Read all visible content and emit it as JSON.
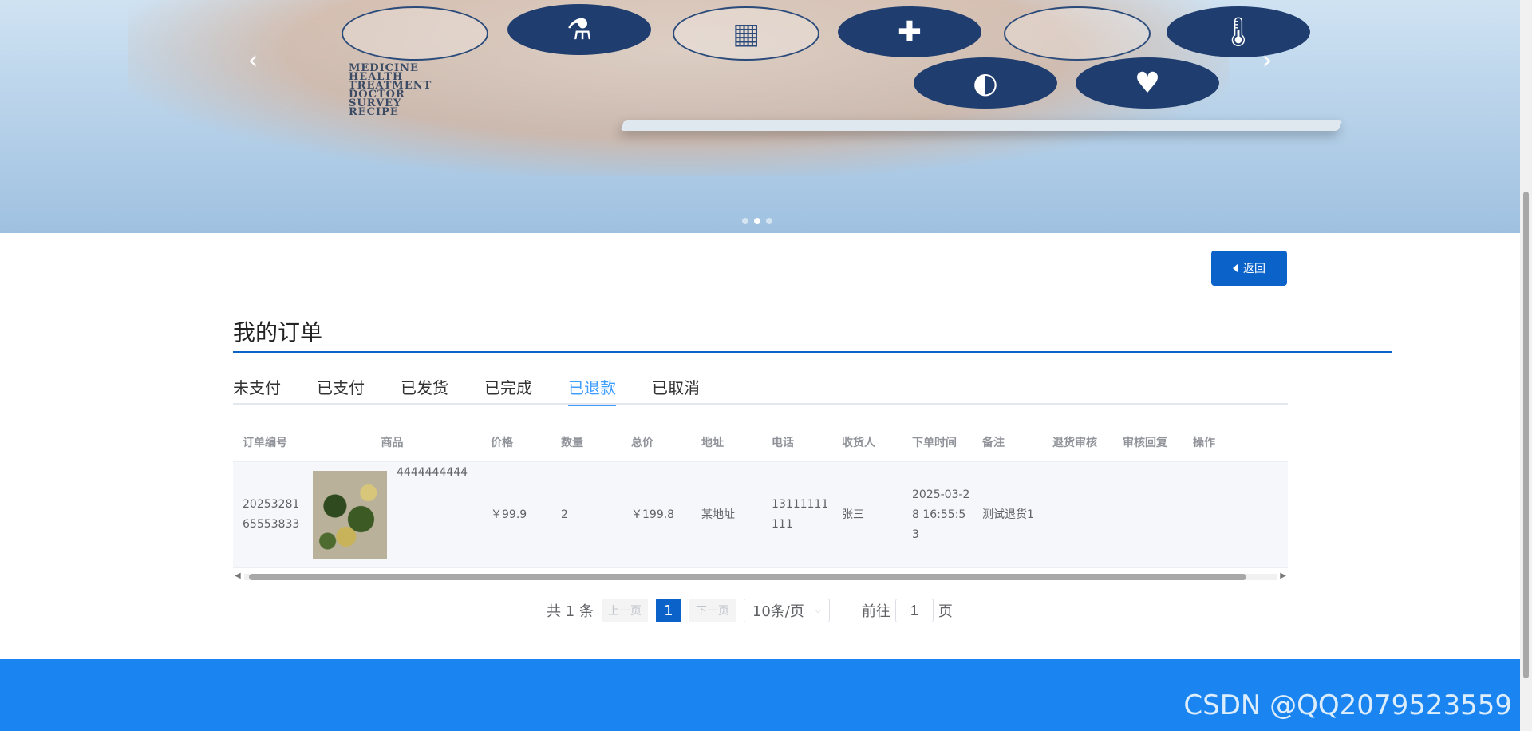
{
  "banner": {
    "text_lines": [
      "MEDICINE",
      "HEALTH",
      "TREATMENT",
      "DOCTOR",
      "SURVEY",
      "RECIPE"
    ],
    "slides": 3,
    "active_slide": 2
  },
  "back_button": {
    "label": "返回"
  },
  "page_title": "我的订单",
  "tabs": [
    "未支付",
    "已支付",
    "已发货",
    "已完成",
    "已退款",
    "已取消"
  ],
  "active_tab": "已退款",
  "table": {
    "columns": [
      "订单编号",
      "商品",
      "价格",
      "数量",
      "总价",
      "地址",
      "电话",
      "收货人",
      "下单时间",
      "备注",
      "退货审核",
      "审核回复",
      "操作"
    ],
    "rows": [
      {
        "order_no": "2025328165553833",
        "product_name": "4444444444",
        "price": "￥99.9",
        "quantity": "2",
        "total": "￥199.8",
        "address": "某地址",
        "phone": "13111111111",
        "receiver": "张三",
        "order_time": "2025-03-28 16:55:53",
        "remark": "测试退货1",
        "return_review": "",
        "review_reply": "",
        "actions": ""
      }
    ]
  },
  "pagination": {
    "total_text": "共 1 条",
    "prev": "上一页",
    "current_page": "1",
    "next": "下一页",
    "page_size": "10条/页",
    "goto_label": "前往",
    "goto_value": "1",
    "page_suffix": "页"
  },
  "footer": {
    "watermark": "CSDN @QQ2079523559"
  },
  "colors": {
    "primary": "#0b63c9",
    "tab_active": "#409eff",
    "footer": "#1a85f0"
  }
}
